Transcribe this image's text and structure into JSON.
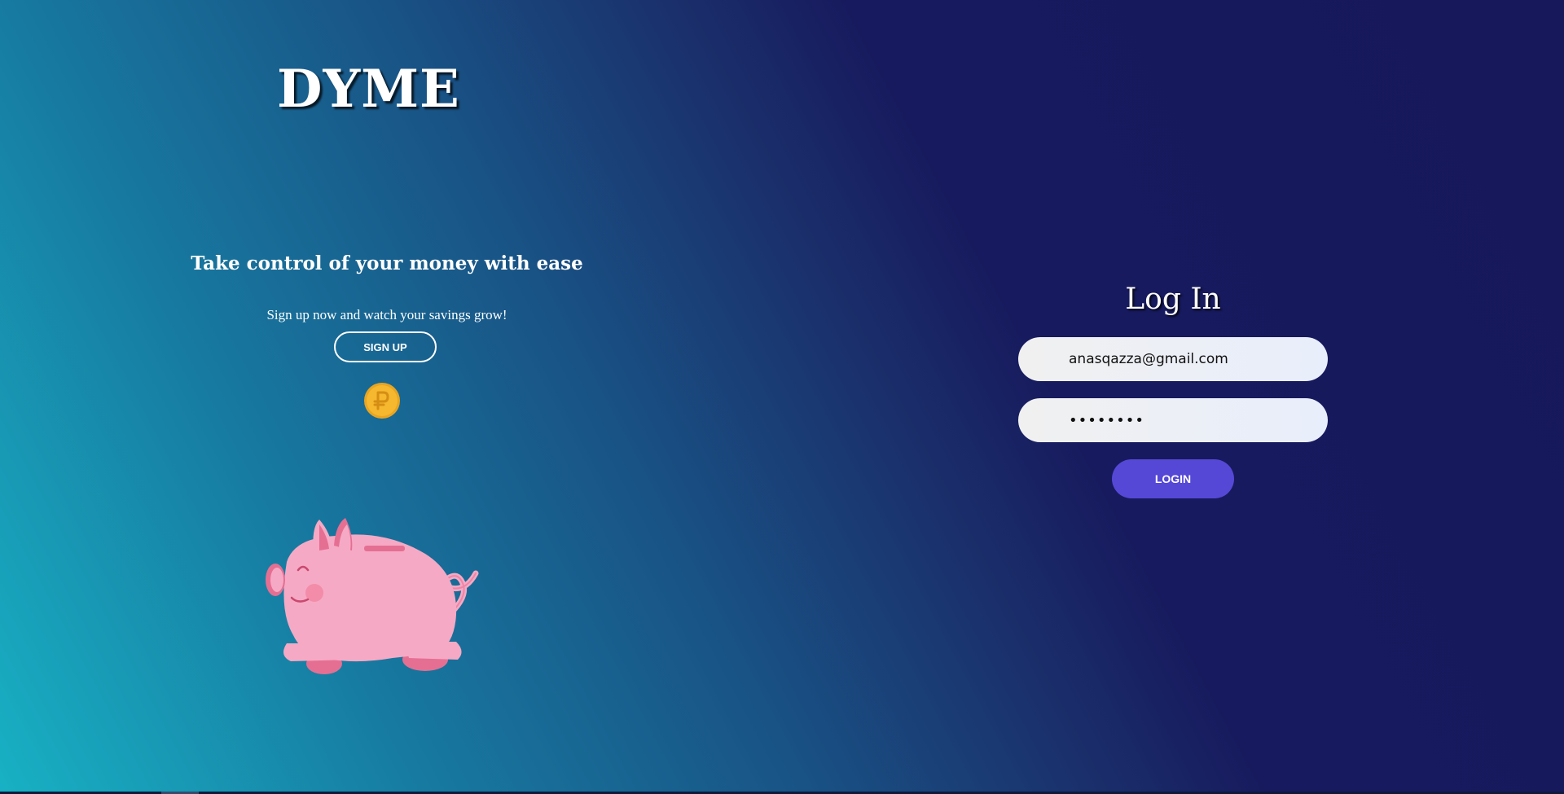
{
  "brand": {
    "logo_text": "DYME"
  },
  "hero": {
    "tagline": "Take control of your money with ease",
    "subline": "Sign up now and watch your savings grow!",
    "signup_label": "SIGN UP",
    "coin_icon": "coin-icon",
    "illustration": "piggy-bank-illustration"
  },
  "login": {
    "title": "Log In",
    "email_value": "anasqazza@gmail.com",
    "password_masked": "••••••••",
    "login_label": "LOGIN"
  },
  "colors": {
    "gradient_start": "#18b1c4",
    "gradient_end": "#17185c",
    "login_button": "#5548d6",
    "coin": "#f5b82e",
    "pig": "#f6a9c4"
  }
}
